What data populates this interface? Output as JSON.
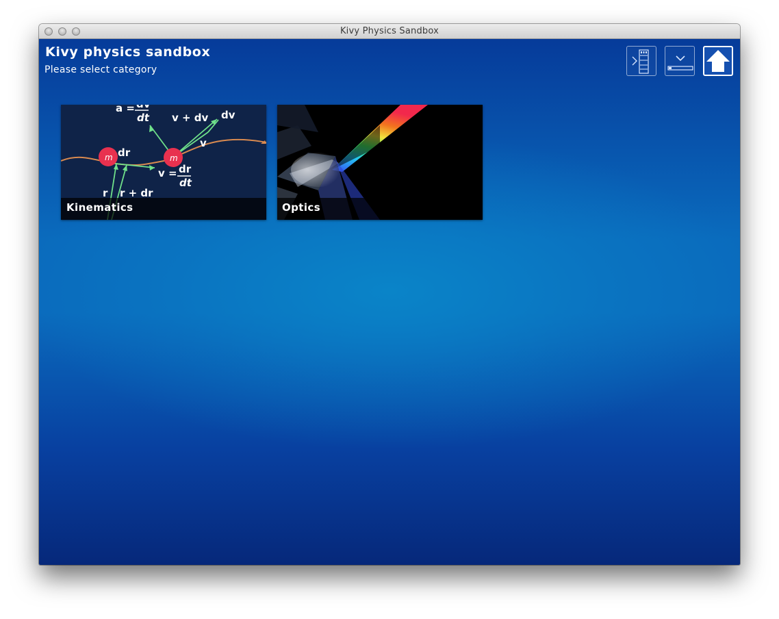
{
  "window": {
    "title": "Kivy Physics Sandbox"
  },
  "header": {
    "title": "Kivy physics sandbox",
    "subtitle": "Please select category"
  },
  "toolbar": {
    "buttons": [
      {
        "icon": "sidebar-toggle-icon"
      },
      {
        "icon": "dropdown-panel-icon"
      },
      {
        "icon": "home-icon"
      }
    ]
  },
  "categories": [
    {
      "label": "Kinematics",
      "image": "kinematics-diagram",
      "diagram_text": {
        "accel_lhs": "a =",
        "accel_num": "dv",
        "accel_den": "dt",
        "v_plus_dv": "v + dv",
        "dv": "dv",
        "v": "v",
        "mass": "m",
        "dr": "dr",
        "v_eq": "v =",
        "frac_num": "dr",
        "frac_den": "dt",
        "r": "r",
        "r_plus_dr": "r + dr"
      }
    },
    {
      "label": "Optics",
      "image": "prism-light-dispersion"
    }
  ],
  "colors": {
    "background_top": "#063b9a",
    "background_mid": "#0a6bbd",
    "card_kinematics_bg": "#0f2348",
    "mass_red": "#e8314f",
    "arrow_green": "#6fe08a",
    "path_orange": "#d98a50"
  }
}
